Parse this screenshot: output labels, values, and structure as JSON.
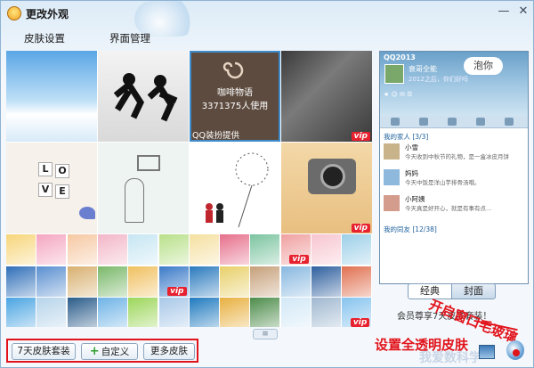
{
  "window": {
    "title": "更改外观",
    "minimize": "—",
    "close": "✕"
  },
  "menu": [
    "皮肤设置",
    "界面管理"
  ],
  "grid": {
    "coffee_title": "咖啡物语",
    "coffee_users": "3371375人使用",
    "qq_tag": "QQ装扮提供",
    "vip_label": "vip",
    "love_letters": [
      "L",
      "O",
      "V",
      "E"
    ]
  },
  "preview": {
    "app_title": "QQ2013",
    "nickname": "衰哥全能",
    "signature": "2012之后，你们好吗",
    "bubble": "泡你",
    "group1": "我的家人 [3/3]",
    "friends": [
      {
        "name": "小雪",
        "status": "今天收到中秋节的礼物，是一盒冰皮月饼"
      },
      {
        "name": "妈妈",
        "status": "今天中饭是洋山芋排骨汤哦。"
      },
      {
        "name": "小阿姨",
        "status": "今天真是好开心，就是有事有点..."
      }
    ],
    "group2": "我的同友 [12/38]"
  },
  "modes": {
    "classic": "经典",
    "cover": "封面"
  },
  "member_note": "会员尊享7天皮肤套装！",
  "annotations": {
    "open_glass": "开启窗口毛玻璃",
    "set_transparent": "设置全透明皮肤",
    "watermark": "我爱数科学"
  },
  "buttons": {
    "seven_day": "7天皮肤套装",
    "plus": "+",
    "custom": "自定义",
    "more": "更多皮肤"
  },
  "collapse": "≡",
  "colors": {
    "accent": "#e1131b",
    "frame": "#8fb3d3",
    "vip": "#e7212e"
  }
}
